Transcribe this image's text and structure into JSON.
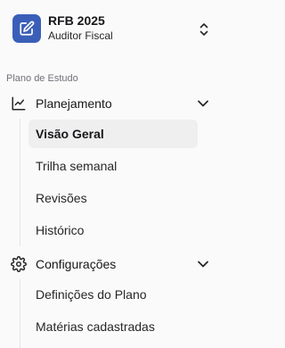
{
  "header": {
    "title": "RFB 2025",
    "subtitle": "Auditor Fiscal",
    "logo_color": "#3b5fb8",
    "logo_icon": "edit-square-icon",
    "switch_icon": "chevrons-up-down-icon"
  },
  "sidebar": {
    "section_label": "Plano de Estudo",
    "groups": [
      {
        "label": "Planejamento",
        "icon": "line-chart-icon",
        "expanded": true,
        "items": [
          {
            "label": "Visão Geral",
            "active": true
          },
          {
            "label": "Trilha semanal",
            "active": false
          },
          {
            "label": "Revisões",
            "active": false
          },
          {
            "label": "Histórico",
            "active": false
          }
        ]
      },
      {
        "label": "Configurações",
        "icon": "gear-icon",
        "expanded": true,
        "items": [
          {
            "label": "Definições do Plano",
            "active": false
          },
          {
            "label": "Matérias cadastradas",
            "active": false
          }
        ]
      }
    ]
  }
}
